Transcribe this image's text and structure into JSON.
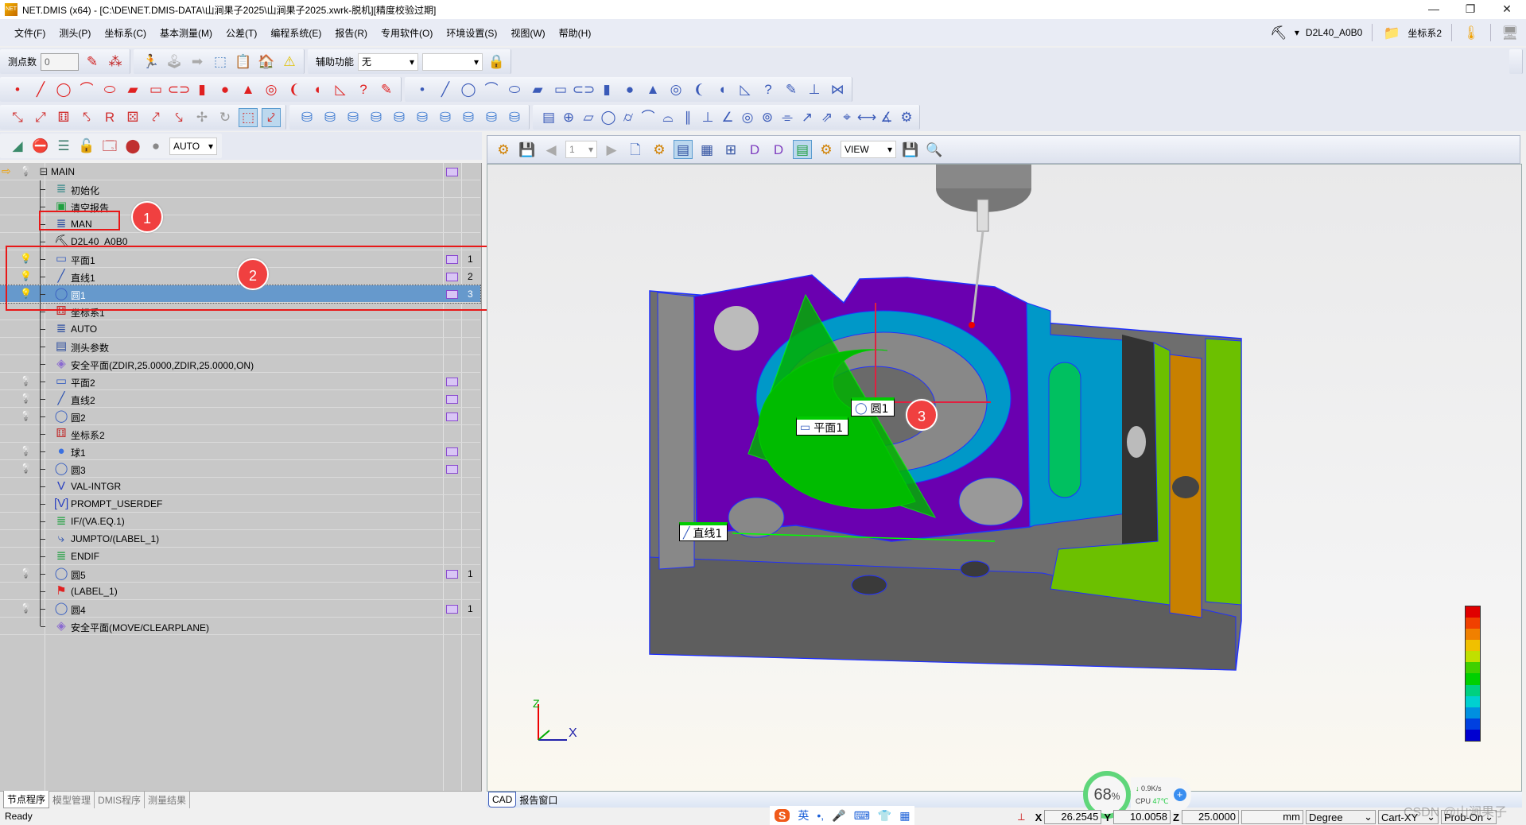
{
  "title": "NET.DMIS (x64) - [C:\\DE\\NET.DMIS-DATA\\山涧果子2025\\山涧果子2025.xwrk-脱机][精度校验过期]",
  "window_controls": [
    "—",
    "❐",
    "✕"
  ],
  "menu": [
    "文件(F)",
    "测头(P)",
    "坐标系(C)",
    "基本测量(M)",
    "公差(T)",
    "编程系统(E)",
    "报告(R)",
    "专用软件(O)",
    "环境设置(S)",
    "视图(W)",
    "帮助(H)"
  ],
  "menu_right": {
    "probe": "D2L40_A0B0",
    "coord_system": "坐标系2"
  },
  "toolbar1": {
    "points_label": "测点数",
    "points_value": "0",
    "assist_label": "辅助功能",
    "assist_value": "无",
    "assist_value2": ""
  },
  "toolbar4": {
    "mode_value": "AUTO"
  },
  "viewport_toolbar": {
    "page_value": "1",
    "view_value": "VIEW"
  },
  "tree": [
    {
      "label": "MAIN",
      "icon": "collapse",
      "bulb": "off",
      "rep": true,
      "num": "",
      "root": true
    },
    {
      "label": "初始化",
      "icon": "init",
      "bulb": "",
      "rep": false,
      "num": ""
    },
    {
      "label": "清空报告",
      "icon": "clear-report",
      "bulb": "",
      "rep": false,
      "num": ""
    },
    {
      "label": "MAN",
      "icon": "mode",
      "bulb": "",
      "rep": false,
      "num": ""
    },
    {
      "label": "D2L40_A0B0",
      "icon": "probe",
      "bulb": "",
      "rep": false,
      "num": ""
    },
    {
      "label": "平面1",
      "icon": "plane",
      "bulb": "on",
      "rep": true,
      "num": "1"
    },
    {
      "label": "直线1",
      "icon": "line",
      "bulb": "on",
      "rep": true,
      "num": "2"
    },
    {
      "label": "圆1",
      "icon": "circle",
      "bulb": "on",
      "rep": true,
      "num": "3",
      "selected": true
    },
    {
      "label": "坐标系1",
      "icon": "coordinate-system",
      "bulb": "",
      "rep": false,
      "num": ""
    },
    {
      "label": "AUTO",
      "icon": "mode",
      "bulb": "",
      "rep": false,
      "num": ""
    },
    {
      "label": "测头参数",
      "icon": "probe-params",
      "bulb": "",
      "rep": false,
      "num": ""
    },
    {
      "label": "安全平面(ZDIR,25.0000,ZDIR,25.0000,ON)",
      "icon": "clearplane",
      "bulb": "",
      "rep": false,
      "num": ""
    },
    {
      "label": "平面2",
      "icon": "plane",
      "bulb": "off",
      "rep": true,
      "num": ""
    },
    {
      "label": "直线2",
      "icon": "line",
      "bulb": "off",
      "rep": true,
      "num": ""
    },
    {
      "label": "圆2",
      "icon": "circle",
      "bulb": "off",
      "rep": true,
      "num": ""
    },
    {
      "label": "坐标系2",
      "icon": "coordinate-system",
      "bulb": "",
      "rep": false,
      "num": ""
    },
    {
      "label": "球1",
      "icon": "sphere",
      "bulb": "off",
      "rep": true,
      "num": ""
    },
    {
      "label": "圆3",
      "icon": "circle",
      "bulb": "off",
      "rep": true,
      "num": ""
    },
    {
      "label": "VAL-INTGR",
      "icon": "variable",
      "bulb": "",
      "rep": false,
      "num": ""
    },
    {
      "label": "PROMPT_USERDEF",
      "icon": "prompt",
      "bulb": "",
      "rep": false,
      "num": ""
    },
    {
      "label": "IF/(VA.EQ.1)",
      "icon": "if",
      "bulb": "",
      "rep": false,
      "num": ""
    },
    {
      "label": "JUMPTO/(LABEL_1)",
      "icon": "jump",
      "bulb": "",
      "rep": false,
      "num": ""
    },
    {
      "label": "ENDIF",
      "icon": "if",
      "bulb": "",
      "rep": false,
      "num": ""
    },
    {
      "label": "圆5",
      "icon": "circle",
      "bulb": "off",
      "rep": true,
      "num": "1"
    },
    {
      "label": "(LABEL_1)",
      "icon": "label-flag",
      "bulb": "",
      "rep": false,
      "num": ""
    },
    {
      "label": "圆4",
      "icon": "circle",
      "bulb": "off",
      "rep": true,
      "num": "1"
    },
    {
      "label": "安全平面(MOVE/CLEARPLANE)",
      "icon": "clearplane",
      "bulb": "",
      "rep": false,
      "num": "",
      "last": true
    }
  ],
  "annotations": {
    "badge1": "1",
    "badge2": "2",
    "badge3": "3"
  },
  "left_tabs": [
    "节点程序",
    "模型管理",
    "DMIS程序",
    "测量结果"
  ],
  "viewport_tabs": [
    "CAD",
    "报告窗口"
  ],
  "feature_labels": {
    "circle": "圆1",
    "plane": "平面1",
    "line": "直线1"
  },
  "axis_labels": {
    "z": "Z",
    "x": "X"
  },
  "status": {
    "ready": "Ready",
    "x_label": "X",
    "x_value": "26.2545",
    "y_label": "Y",
    "y_value": "10.0058",
    "z_label": "Z",
    "z_value": "25.0000",
    "unit": "mm",
    "angle": "Degree",
    "coord_type": "Cart-XY",
    "probe_state": "Prob-On"
  },
  "cpu_widget": {
    "percent": "68",
    "unit": "%",
    "net": "0.9K/s",
    "cpu_label": "CPU",
    "cpu_temp": "47℃"
  },
  "ime": {
    "lang": "英",
    "punct": "•,"
  },
  "watermark": "CSDN @山涧果子",
  "colors": {
    "selection": "#6699cc",
    "badge": "#f04040",
    "highlight_box": "#e81818",
    "part_purple": "#6a00b0",
    "part_cyan": "#0098c8",
    "feature_green": "#00bb00"
  },
  "color_legend": [
    "#e00000",
    "#f04000",
    "#f08000",
    "#f0c000",
    "#c0e000",
    "#40d000",
    "#00d000",
    "#00d080",
    "#00d0d0",
    "#0090e0",
    "#0040e0",
    "#0000d0"
  ]
}
